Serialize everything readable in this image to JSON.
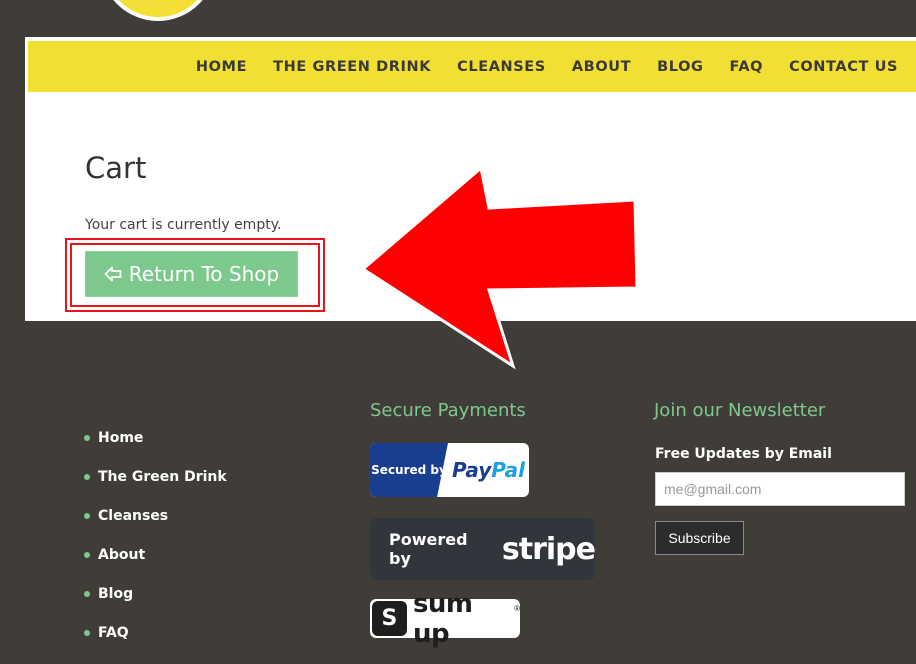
{
  "nav": {
    "items": [
      "HOME",
      "THE GREEN DRINK",
      "CLEANSES",
      "ABOUT",
      "BLOG",
      "FAQ",
      "CONTACT US"
    ]
  },
  "cart": {
    "title": "Cart",
    "empty_message": "Your cart is currently empty.",
    "return_button": "Return To Shop",
    "return_icon": "arrow-left-outline-icon"
  },
  "annotation": {
    "arrow_color": "#ff0000",
    "highlight_color": "#e8141b"
  },
  "footer": {
    "menu": {
      "items": [
        "Home",
        "The Green Drink",
        "Cleanses",
        "About",
        "Blog",
        "FAQ"
      ]
    },
    "payments": {
      "title": "Secure Payments",
      "paypal_prefix": "Secured by",
      "paypal_pay": "Pay",
      "paypal_pal": "Pal",
      "stripe_prefix": "Powered by",
      "stripe_word": "stripe",
      "sumup_mark": "S",
      "sumup_word": "sum up",
      "sumup_reg": "®"
    },
    "newsletter": {
      "title": "Join our Newsletter",
      "label": "Free Updates by Email",
      "placeholder": "me@gmail.com",
      "button": "Subscribe"
    }
  },
  "colors": {
    "background": "#403d39",
    "nav_yellow": "#f2df33",
    "accent_green": "#7dc88c",
    "paypal_blue": "#1a3e8f"
  }
}
